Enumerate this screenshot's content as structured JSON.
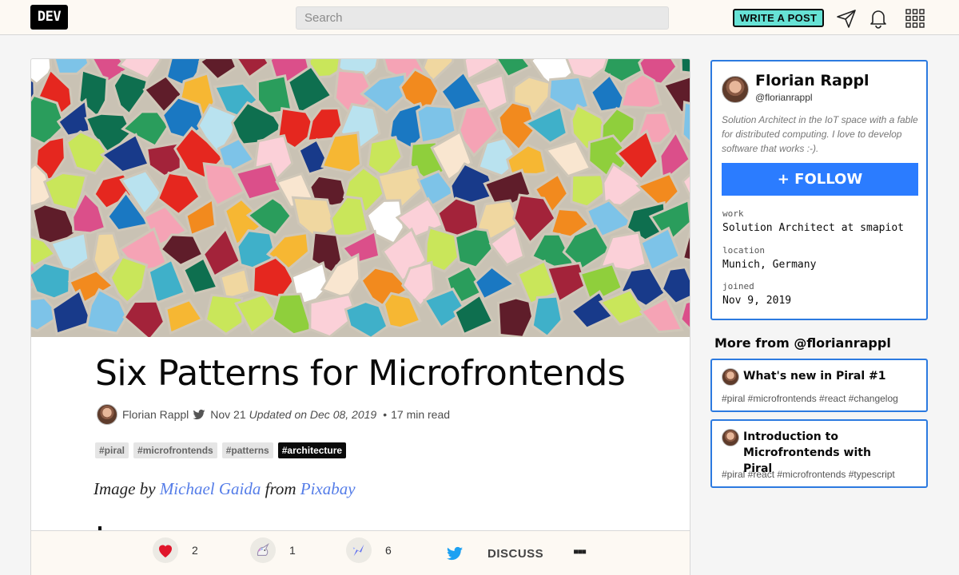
{
  "header": {
    "logo_text": "DEV",
    "search_placeholder": "Search",
    "write_button_label": "WRITE A POST"
  },
  "article": {
    "title": "Six Patterns for Microfrontends",
    "author": "Florian Rappl",
    "published": "Nov 21",
    "updated": "Updated on Dec 08, 2019",
    "read_time": "17 min read",
    "tags": [
      "#piral",
      "#microfrontends",
      "#patterns",
      "#architecture"
    ],
    "caption": {
      "prefix": "Image by",
      "author_link": "Michael Gaida",
      "middle": "from",
      "source_link": "Pixabay"
    }
  },
  "reactions": {
    "hearts": "2",
    "unicorns": "1",
    "bookmarks": "6",
    "discuss_label": "DISCUSS",
    "more_label": "▪▪▪"
  },
  "profile": {
    "name": "Florian Rappl",
    "handle": "@florianrappl",
    "bio": "Solution Architect in the IoT space with a fable for distributed computing. I love to develop software that works :-).",
    "follow_label": "+ FOLLOW",
    "fields": [
      {
        "key": "work",
        "value": "Solution Architect at smapiot"
      },
      {
        "key": "location",
        "value": "Munich, Germany"
      },
      {
        "key": "joined",
        "value": "Nov 9, 2019"
      }
    ]
  },
  "more_from": {
    "heading": "More from @florianrappl",
    "posts": [
      {
        "title": "What's new in Piral #1",
        "tags": "#piral #microfrontends #react #changelog"
      },
      {
        "title": "Introduction to Microfrontends with Piral",
        "tags": "#piral #react #microfrontends #typescript"
      }
    ]
  },
  "colors": {
    "accent_blue": "#2b7cff",
    "write_button": "#66e2d5",
    "caption_link": "#557de8",
    "header_bg": "#fdf9f3"
  }
}
